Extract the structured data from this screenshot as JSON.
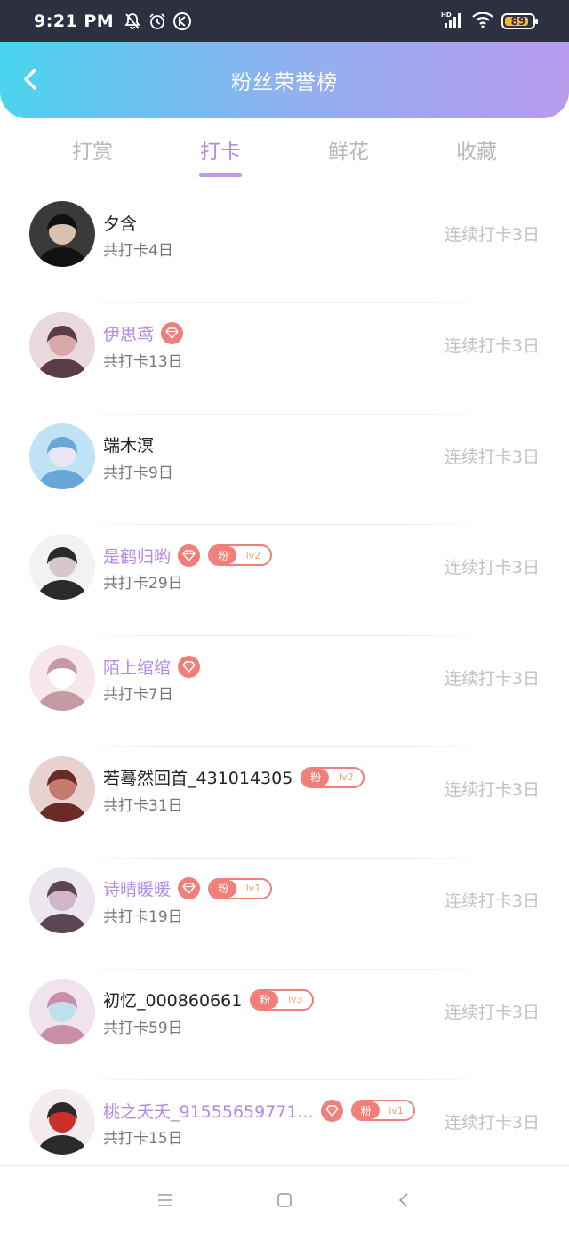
{
  "status_bar": {
    "time": "9:21 PM",
    "left_icons": [
      "bell-muted-icon",
      "alarm-icon",
      "k-app-icon"
    ],
    "right_icons": [
      "hd-signal-icon",
      "wifi-icon",
      "battery-icon"
    ],
    "battery_level": 89,
    "battery_text": "89"
  },
  "header": {
    "title": "粉丝荣誉榜",
    "back_icon": "chevron-left-icon",
    "gradient": [
      "#4ad4ee",
      "#b89bec"
    ]
  },
  "tabs": [
    {
      "label": "打赏",
      "active": false
    },
    {
      "label": "打卡",
      "active": true
    },
    {
      "label": "鲜花",
      "active": false
    },
    {
      "label": "收藏",
      "active": false
    }
  ],
  "colors": {
    "accent": "#b48be3",
    "badge": "#f07f7a",
    "muted_text": "#c2c2c2"
  },
  "fans": [
    {
      "name": "夕含",
      "vip": false,
      "gem": false,
      "fan_level": "",
      "total": "共打卡4日",
      "streak": "连续打卡3日"
    },
    {
      "name": "伊思鸢",
      "vip": true,
      "gem": true,
      "fan_level": "",
      "total": "共打卡13日",
      "streak": "连续打卡3日"
    },
    {
      "name": "端木溟",
      "vip": false,
      "gem": false,
      "fan_level": "",
      "total": "共打卡9日",
      "streak": "连续打卡3日"
    },
    {
      "name": "是鹤归哟",
      "vip": true,
      "gem": true,
      "fan_level": "lv2",
      "total": "共打卡29日",
      "streak": "连续打卡3日"
    },
    {
      "name": "陌上绾绾",
      "vip": true,
      "gem": true,
      "fan_level": "",
      "total": "共打卡7日",
      "streak": "连续打卡3日"
    },
    {
      "name": "若蓦然回首_431014305",
      "vip": false,
      "gem": false,
      "fan_level": "lv2",
      "total": "共打卡31日",
      "streak": "连续打卡3日"
    },
    {
      "name": "诗晴暖暖",
      "vip": true,
      "gem": true,
      "fan_level": "lv1",
      "total": "共打卡19日",
      "streak": "连续打卡3日"
    },
    {
      "name": "初忆_000860661",
      "vip": false,
      "gem": false,
      "fan_level": "lv3",
      "total": "共打卡59日",
      "streak": "连续打卡3日"
    },
    {
      "name": "桃之夭夭_91555659771...",
      "vip": true,
      "gem": true,
      "fan_level": "lv1",
      "total": "共打卡15日",
      "streak": "连续打卡3日"
    }
  ],
  "fan_badge_label": "粉",
  "navbar": {
    "icons": [
      "menu-icon",
      "home-square-icon",
      "back-triangle-icon"
    ]
  }
}
